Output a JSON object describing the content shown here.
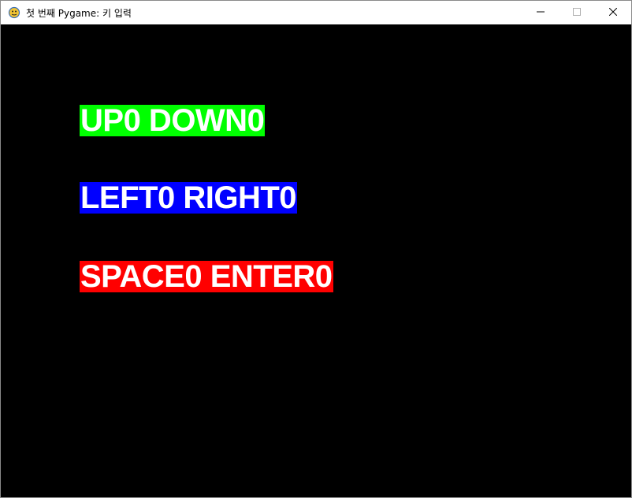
{
  "window": {
    "title": "첫 번째 Pygame: 키 입력",
    "app_icon": "pygame-snake-icon"
  },
  "controls": {
    "minimize_icon": "minimize-icon",
    "maximize_icon": "maximize-icon",
    "close_icon": "close-icon"
  },
  "labels": {
    "up_down": "UP0 DOWN0",
    "left_right": "LEFT0 RIGHT0",
    "space_enter": "SPACE0 ENTER0"
  },
  "colors": {
    "background": "#000000",
    "up_down_bg": "#00ff00",
    "left_right_bg": "#0000ff",
    "space_enter_bg": "#ff0000",
    "text": "#ffffff"
  }
}
